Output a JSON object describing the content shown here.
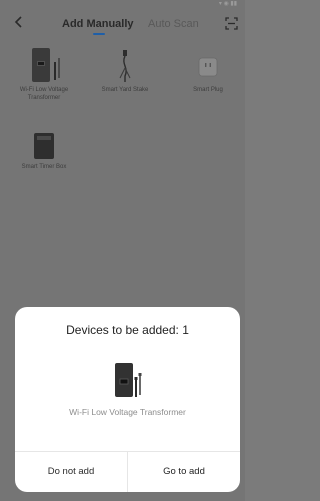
{
  "nav": {
    "tab_manual": "Add Manually",
    "tab_scan": "Auto Scan"
  },
  "devices": [
    {
      "label": "Wi-Fi Low Voltage Transformer"
    },
    {
      "label": "Smart Yard Stake"
    },
    {
      "label": "Smart Plug"
    },
    {
      "label": "Smart Timer Box"
    }
  ],
  "sheet": {
    "title": "Devices to be added: 1",
    "device_label": "Wi-Fi Low Voltage Transformer",
    "cancel_label": "Do not add",
    "confirm_label": "Go to add"
  },
  "colors": {
    "accent": "#1f5fa8",
    "overlay": "#757575",
    "sheet_bg": "#ffffff"
  },
  "icons": {
    "back": "chevron-left-icon",
    "scan": "scan-frame-icon"
  }
}
